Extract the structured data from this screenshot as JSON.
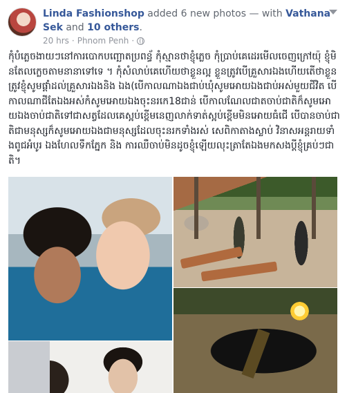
{
  "post": {
    "author": "Linda Fashionshop",
    "action": "added 6 new photos — with",
    "tagged_person": "Vathana Sek",
    "and_word": "and",
    "others_link": "10 others",
    "period": ".",
    "time": "20 hrs",
    "separator": "·",
    "location": "Phnom Penh",
    "separator2": "·",
    "body": "កុំបំភ្លេចងាយៗនៅការបោកបញ្ឆោតប្រពន្ធ័ កុំស្មានថាខ្ញុំភ្លេច កុំប្រាប់គេដេរមើលចេញក្រៅយ៉ុ ខ្ញុំមិនតែលក្លេចតាមនានាទៅទេ ។ កុំសំលាប់គេហើយថាខ្លួនល្អ ខ្លួនត្រូវបើគ្រួសារឯងហើយតើថាខ្លួនត្រូវខ្ញុំសូមផ្តាំដល់គ្រួសារឯងនិង ឯង(បើកាលណាឯងជាប់ឃុំសូមអោយឯងជាប់អស់មួយជីវិត បើកាលណាជីតែឯងអស់កំសូមអោយឯងចុះនរកេ18ជាន់ បើកាលណែលជាតចាប់ជាតិក៏សូមអោយឯងចាប់ជាតិទៅជាសត្វដែលគេស្អប់ខ្ពើមនេញលាក់ទាត់ស្អប់ខ្ពើមមិនអោយធំជើ បើបានចាប់ជាតិជាមនុស្សក៏សូមអោយឯងជាមនុស្សដែលចុះនរកទាំងរស់ សេពិកាតាងស្លាប់ វិនាសអន្តរាយទាំងពូជអំបូរ ឯងហែលទឹកភ្នែក និង ការឈឺចាប់មិនដូចខ្ញុំឡើយលុះត្រាតែឯងមកសងប្តីខ្ញុំគ្រប់ៗជាតិ។"
  },
  "icons": {
    "location": "globe-icon",
    "menu": "chevron-down-icon"
  },
  "colors": {
    "link": "#365899",
    "meta": "#90949c",
    "text": "#1d2129"
  }
}
